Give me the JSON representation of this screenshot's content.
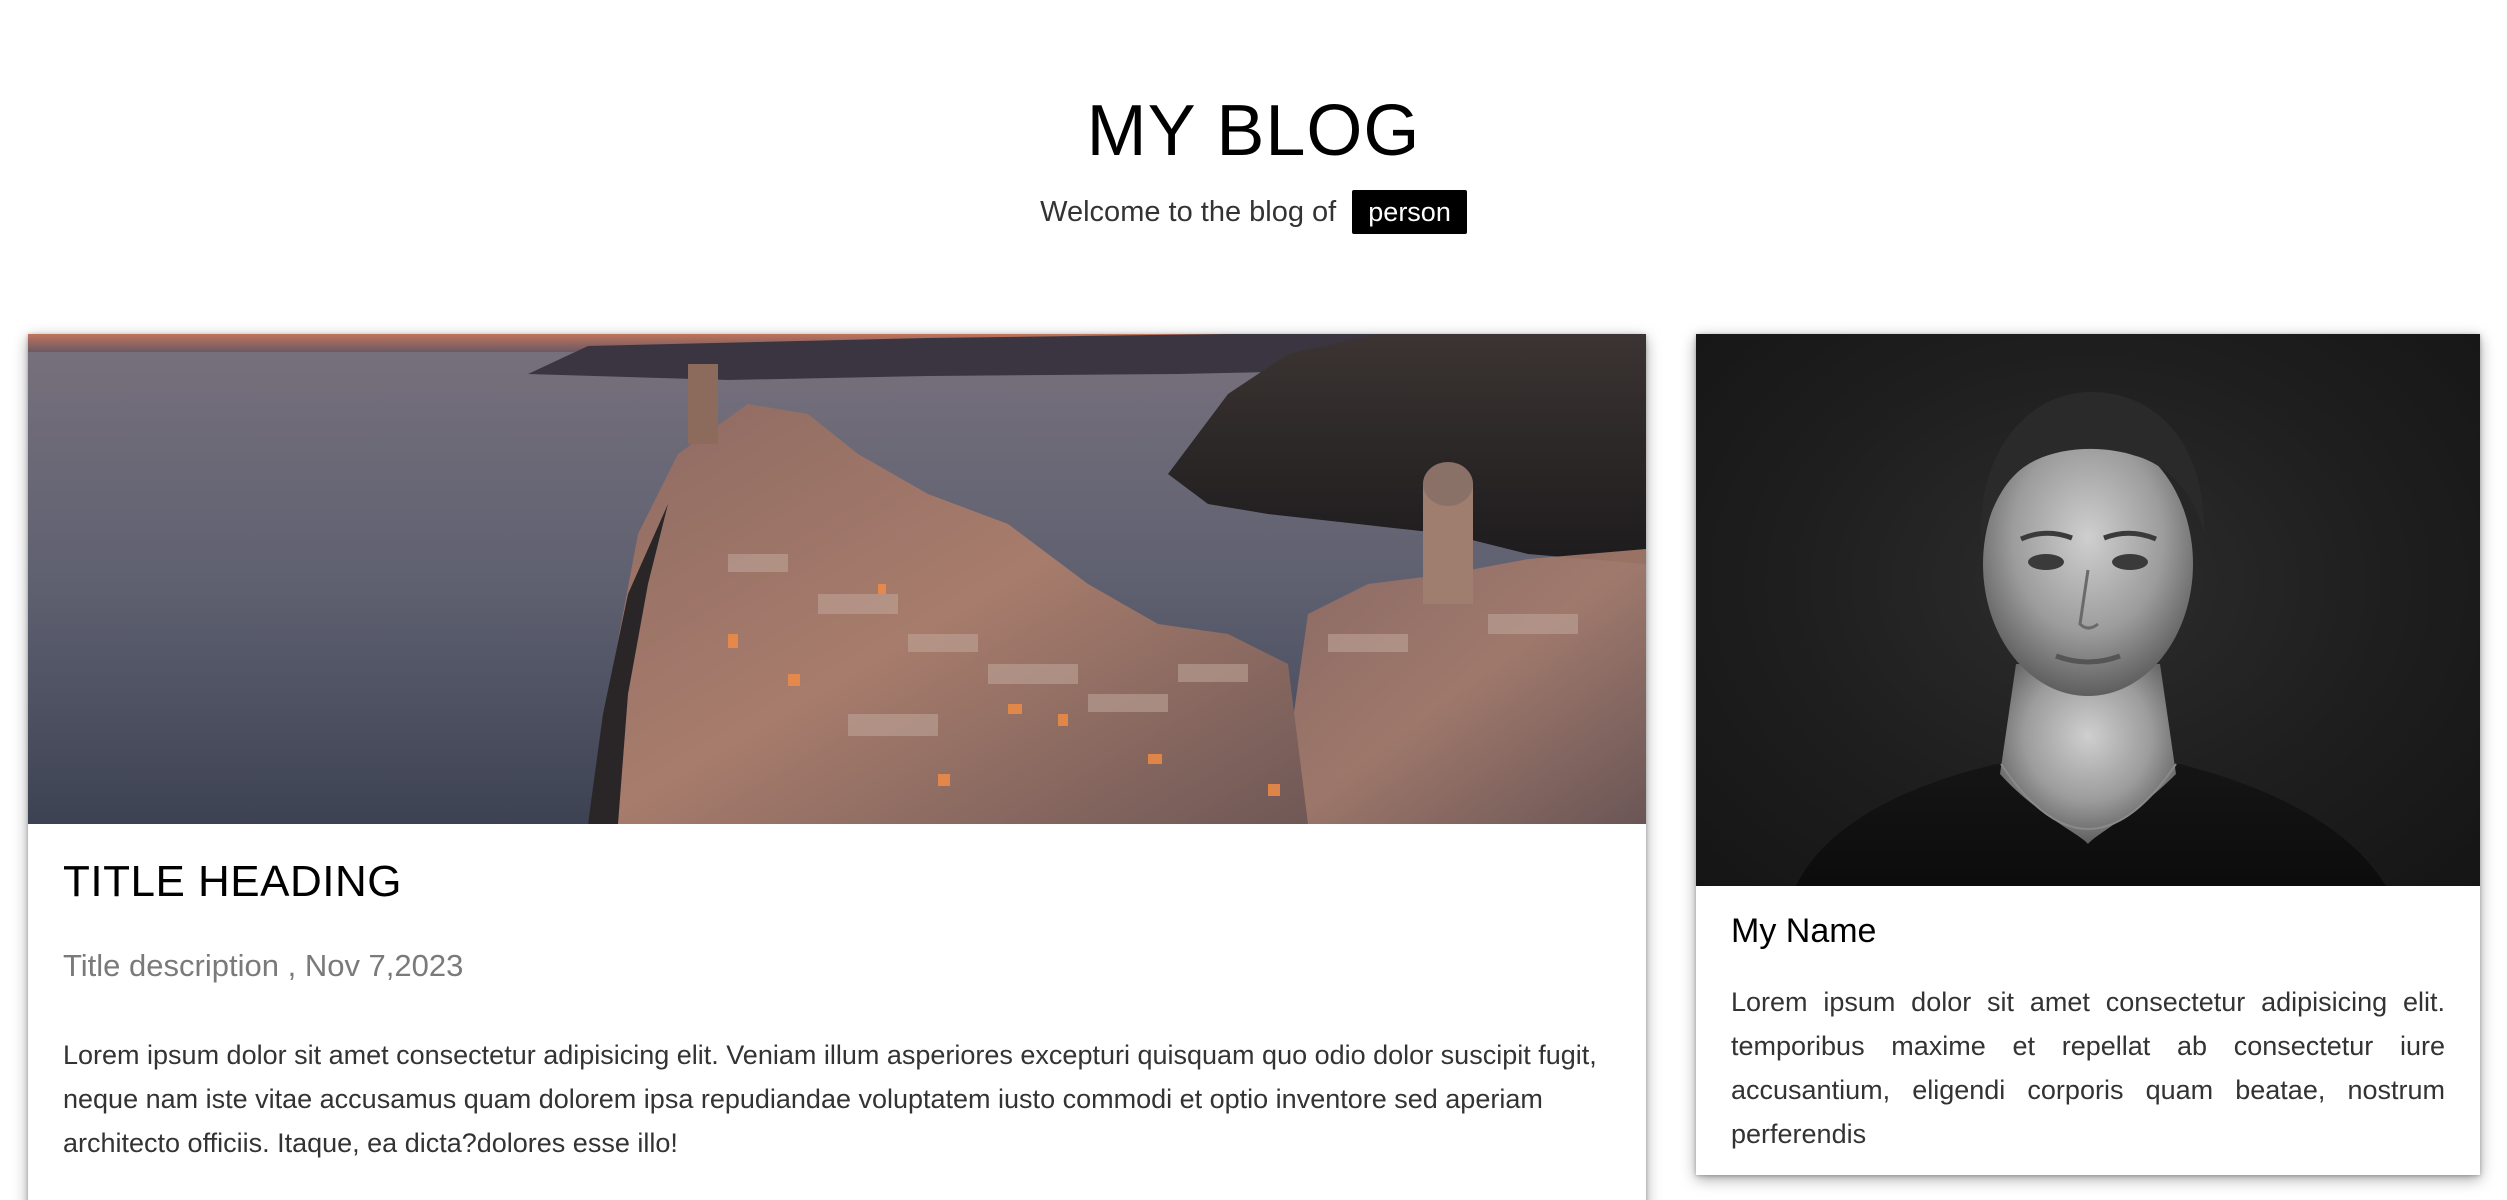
{
  "header": {
    "title": "MY BLOG",
    "tagline": "Welcome to the blog of",
    "badge": "person"
  },
  "post": {
    "image_icon": "coastal-village-photo",
    "title": "TITLE HEADING",
    "description": "Title description",
    "date": "Nov 7,2023",
    "body": "Lorem ipsum dolor sit amet consectetur adipisicing elit. Veniam illum asperiores excepturi quisquam quo odio dolor suscipit fugit, neque nam iste vitae accusamus quam dolorem ipsa repudiandae voluptatem iusto commodi et optio inventore sed aperiam architecto officiis. Itaque, ea dicta?dolores esse illo!"
  },
  "profile": {
    "image_icon": "portrait-photo",
    "name": "My Name",
    "bio": "Lorem ipsum dolor sit amet consectetur adipisicing elit. temporibus maxime et repellat ab consectetur iure accusantium, eligendi corporis quam beatae, nostrum perferendis"
  },
  "colors": {
    "badge_bg": "#000000",
    "badge_text": "#ffffff",
    "meta_text": "#7a7a7a",
    "body_text": "#333333"
  }
}
